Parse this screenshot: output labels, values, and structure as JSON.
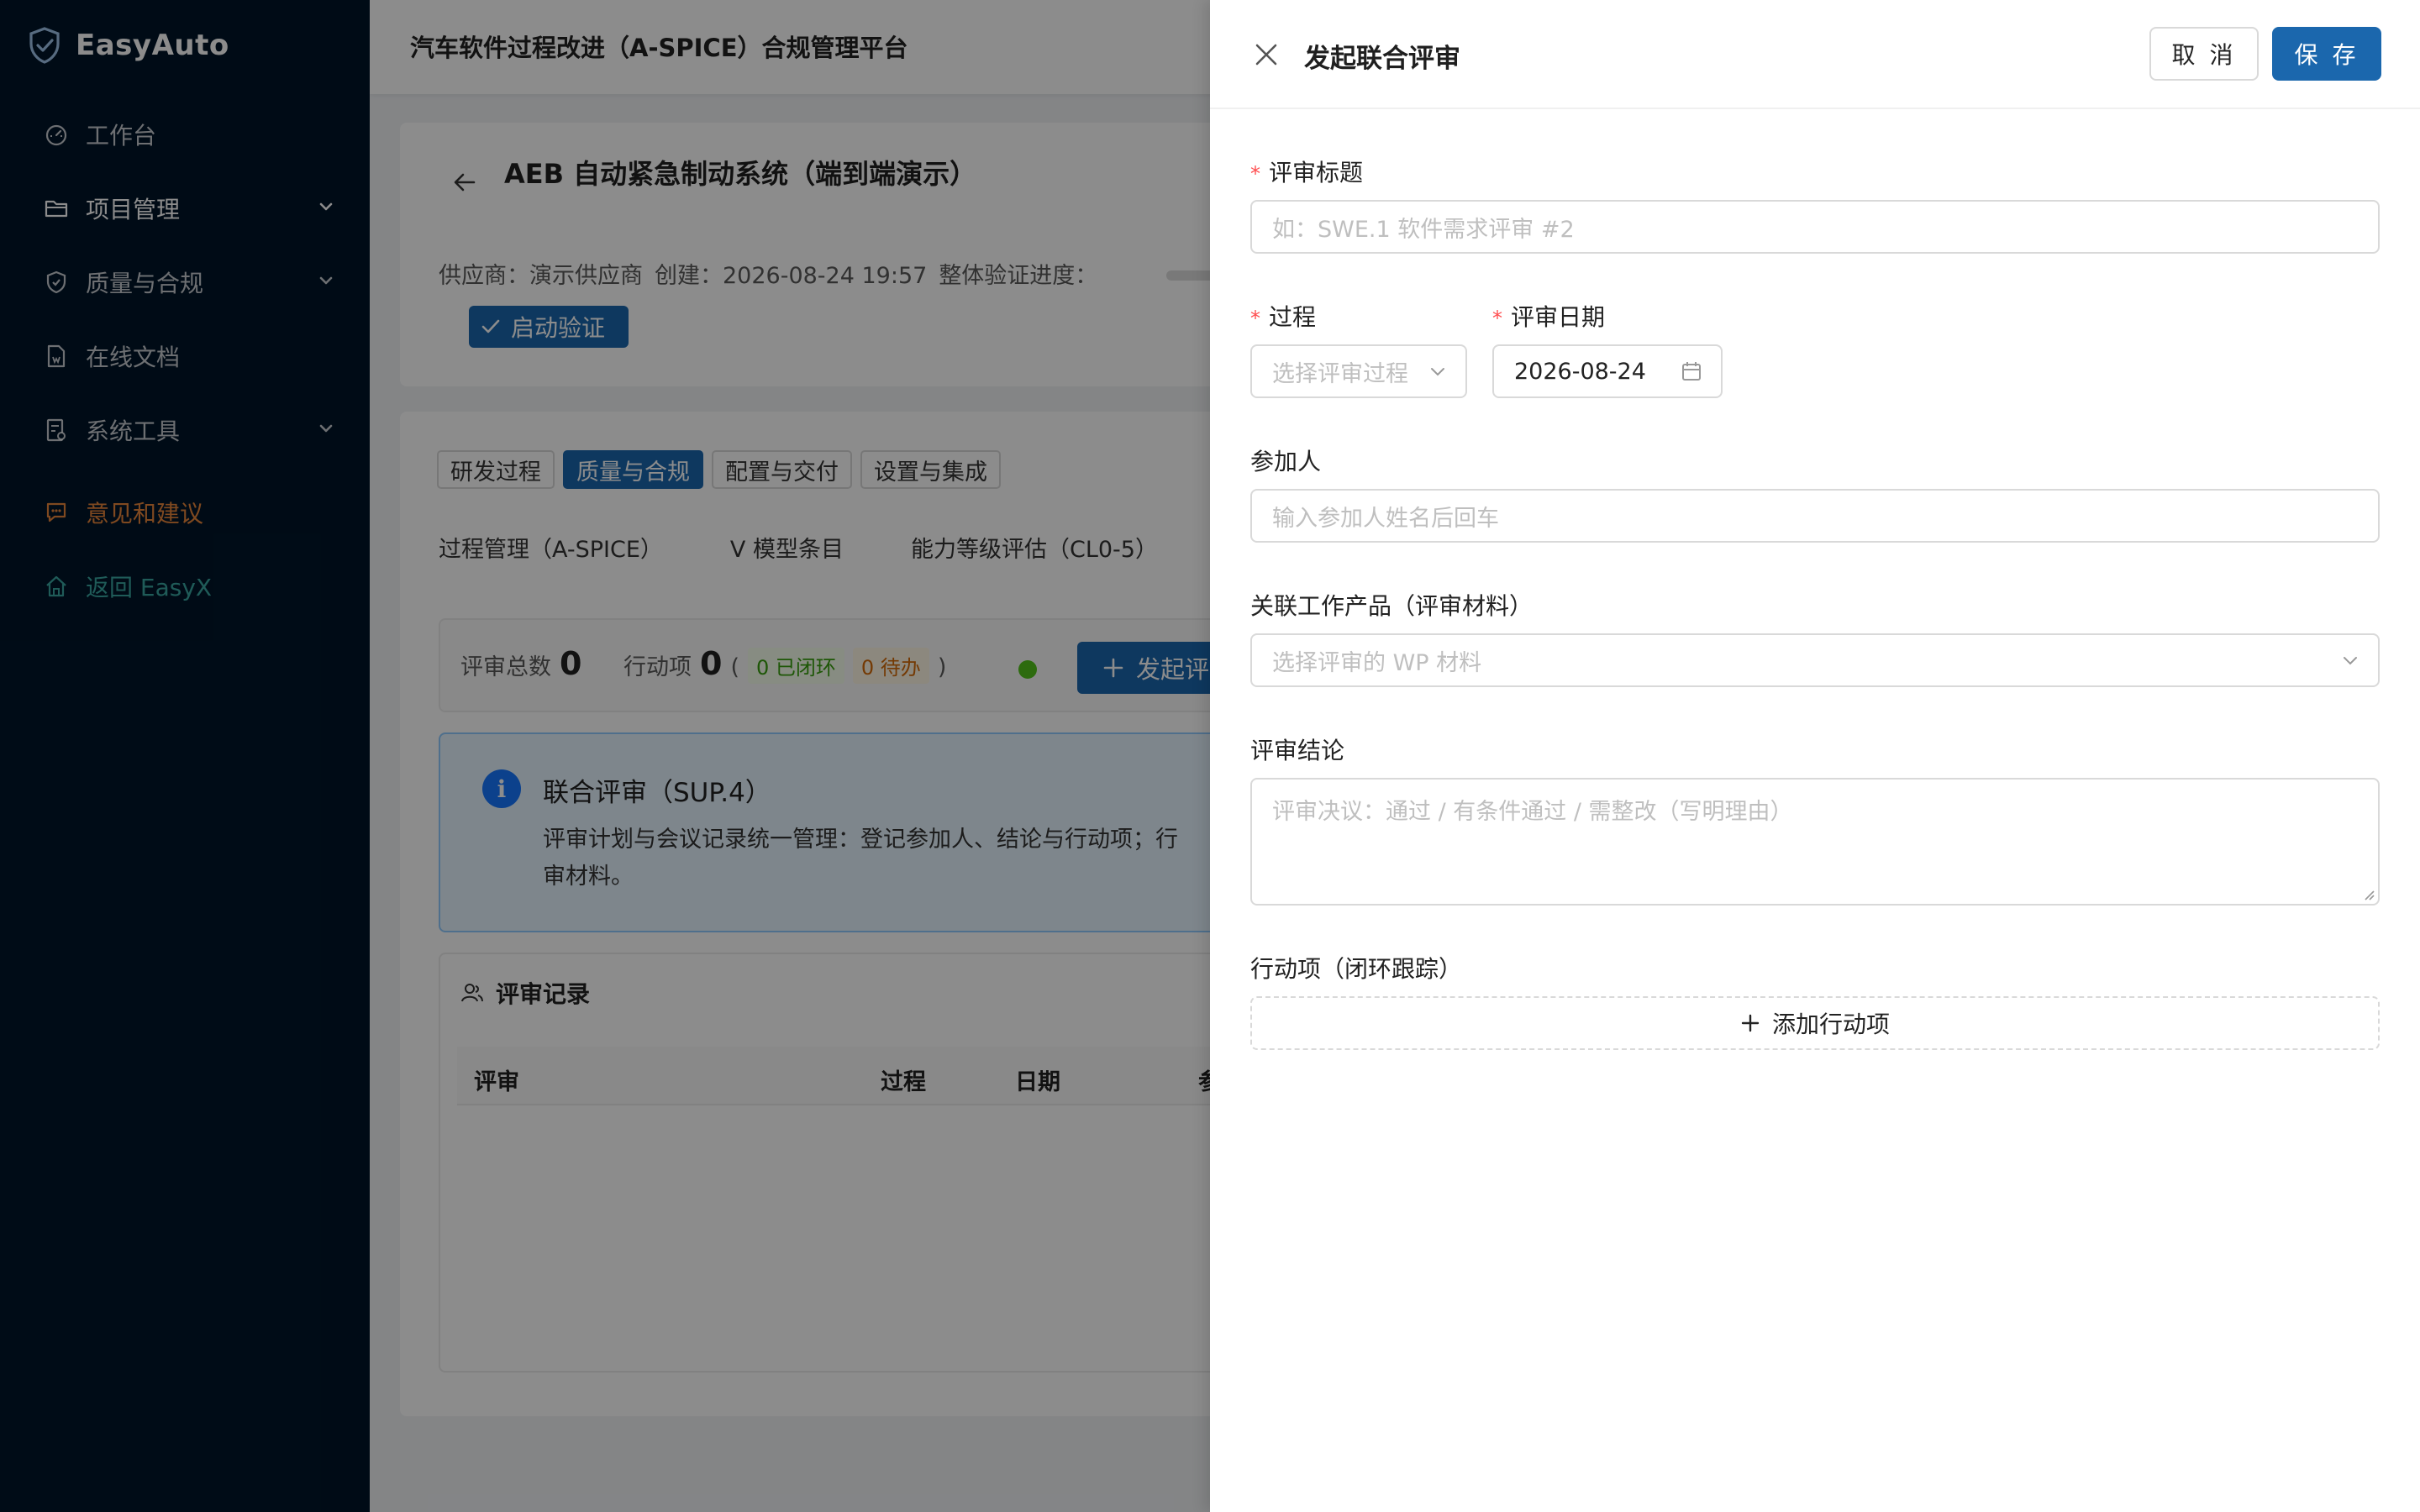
{
  "app": {
    "logo_text": "EasyAuto"
  },
  "sidebar": {
    "items": [
      {
        "label": "工作台",
        "icon": "dashboard-icon"
      },
      {
        "label": "项目管理",
        "icon": "folder-icon",
        "expandable": true
      },
      {
        "label": "质量与合规",
        "icon": "shield-icon",
        "expandable": true
      },
      {
        "label": "在线文档",
        "icon": "document-icon"
      },
      {
        "label": "系统工具",
        "icon": "tools-icon",
        "expandable": true
      },
      {
        "label": "意见和建议",
        "icon": "feedback-icon"
      },
      {
        "label": "返回 EasyX",
        "icon": "home-icon"
      }
    ]
  },
  "header": {
    "title": "汽车软件过程改进（A-SPICE）合规管理平台"
  },
  "project": {
    "title": "AEB 自动紧急制动系统（端到端演示）",
    "supplier": "供应商：演示供应商",
    "created": "创建：2026-08-24 19:57",
    "progress_label": "整体验证进度：",
    "start_button": "启动验证"
  },
  "tabs": {
    "chips": [
      "研发过程",
      "质量与合规",
      "配置与交付",
      "设置与集成"
    ],
    "active_chip": 1,
    "subtabs": [
      "过程管理（A-SPICE）",
      "V 模型条目",
      "能力等级评估（CL0-5）"
    ]
  },
  "stats": {
    "review_total_label": "评审总数",
    "review_total": "0",
    "action_label": "行动项",
    "action_total": "0",
    "open_paren": "(",
    "closed_tag": "0 已闭环",
    "pending_tag": "0 待办",
    "close_paren": ")",
    "launch_button": "发起评"
  },
  "info": {
    "icon_text": "i",
    "title": "联合评审（SUP.4）",
    "desc": "评审计划与会议记录统一管理：登记参加人、结论与行动项；行",
    "desc_line2": "审材料。"
  },
  "records": {
    "title": "评审记录",
    "columns": [
      "评审",
      "过程",
      "日期",
      "参"
    ]
  },
  "drawer": {
    "title": "发起联合评审",
    "cancel": "取 消",
    "save": "保 存",
    "fields": {
      "title_label": "评审标题",
      "title_placeholder": "如：SWE.1 软件需求评审 #2",
      "process_label": "过程",
      "process_placeholder": "选择评审过程",
      "date_label": "评审日期",
      "date_value": "2026-08-24",
      "participants_label": "参加人",
      "participants_placeholder": "输入参加人姓名后回车",
      "wp_label": "关联工作产品（评审材料）",
      "wp_placeholder": "选择评审的 WP 材料",
      "conclusion_label": "评审结论",
      "conclusion_placeholder": "评审决议：通过 / 有条件通过 / 需整改（写明理由）",
      "actions_label": "行动项（闭环跟踪）",
      "add_action": "添加行动项"
    },
    "required_mark": "*"
  },
  "colors": {
    "sidebar_bg": "#001529",
    "primary": "#1b67ad",
    "feedback": "#e8853b",
    "back_link": "#3aa6a0",
    "required": "#ff4d4f"
  }
}
